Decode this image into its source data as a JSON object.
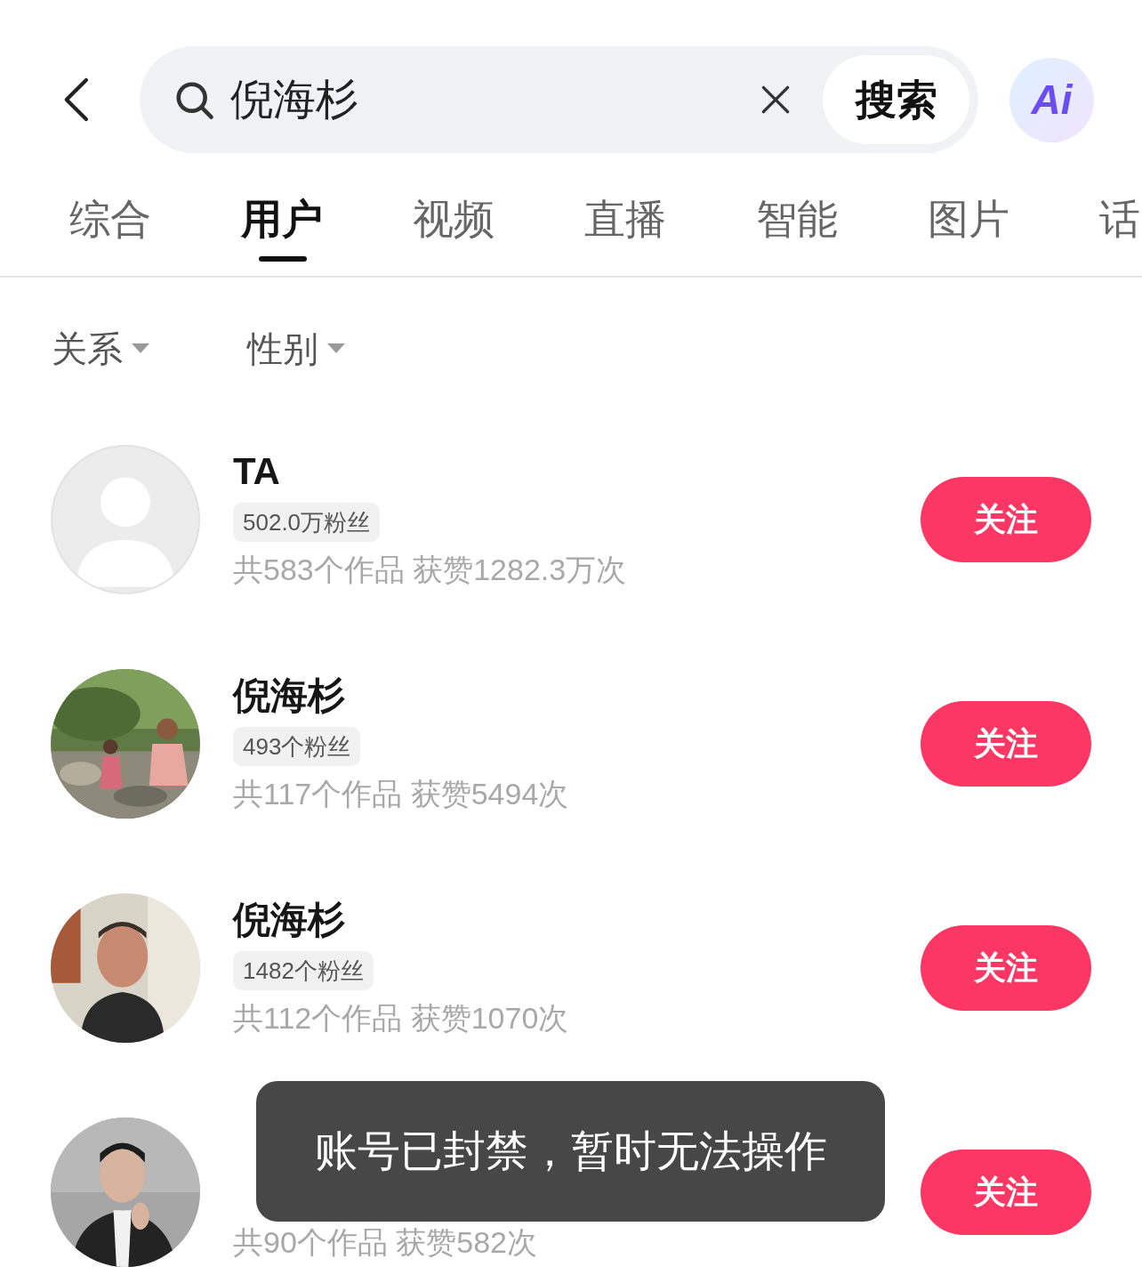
{
  "search": {
    "query": "倪海杉",
    "button": "搜索"
  },
  "ai_button": {
    "label": "Ai"
  },
  "tabs": [
    {
      "label": "综合",
      "selected": false
    },
    {
      "label": "用户",
      "selected": true
    },
    {
      "label": "视频",
      "selected": false
    },
    {
      "label": "直播",
      "selected": false
    },
    {
      "label": "智能",
      "selected": false
    },
    {
      "label": "图片",
      "selected": false
    },
    {
      "label": "话",
      "selected": false
    }
  ],
  "filters": [
    {
      "label": "关系"
    },
    {
      "label": "性别"
    }
  ],
  "users": [
    {
      "avatar": {
        "kind": "placeholder"
      },
      "name": "TA",
      "fans": "502.0万粉丝",
      "stats": "共583个作品 获赞1282.3万次",
      "button": "关注"
    },
    {
      "name": "倪海杉",
      "fans": "493个粉丝",
      "stats": "共117个作品 获赞5494次",
      "button": "关注"
    },
    {
      "name": "倪海杉",
      "fans": "1482个粉丝",
      "stats": "共112个作品 获赞1070次",
      "button": "关注"
    },
    {
      "stats": "共90个作品 获赞582次",
      "button": "关注"
    }
  ],
  "toast": "账号已封禁，暂时无法操作"
}
